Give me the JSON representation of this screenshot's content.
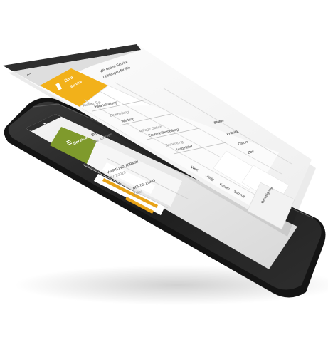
{
  "colors": {
    "phone_body": "#2b2b2b",
    "phone_edge": "#4a4a4a",
    "screen_bg": "#eeeeee",
    "card_bg": "#fafafa",
    "status_bar": "#2e2e2e",
    "accent_yellow": "#f2b11a",
    "accent_green": "#7f9a2c",
    "accent_orange": "#e8a318"
  },
  "card": {
    "status_bar": {
      "signal_icon": "signal-icon",
      "battery_icon": "battery-icon"
    },
    "header": {
      "back_icon": "back-arrow-icon",
      "tile_title": "Diva",
      "tile_subtitle": "Service",
      "tile_icon": "figure-icon",
      "info_line1": "Wir haben Service",
      "info_line2": "Leistungen für Sie"
    },
    "form": {
      "field1_label": "Auftrag Typ",
      "field1_value": "Instandhaltung",
      "field2_label": "Bearbeitung",
      "field2_value": "Wartung",
      "field3_label": "Anfrage Datum",
      "field3_value": "Ersatzteilbestellung",
      "field4_label": "Bemerkung",
      "field4_value": "Ausgeführt",
      "right_labels": [
        "Status",
        "Priorität",
        "Datum",
        "Zeit"
      ],
      "list_items": [
        "Wert",
        "Gültig",
        "Kosten",
        "Summe"
      ],
      "bottom_label": "Bestätigung"
    }
  },
  "phone": {
    "status_bar_icon": "status-icon",
    "tile_title": "Service",
    "tile_menu_icon": "menu-icon",
    "header_text": "Willkommen",
    "subheader_text": "Ihre Aufträge",
    "section_label": "Auftragsliste",
    "list_item1_title": "WARTUNG TERMIN",
    "list_item1_sub": "06.07.2015",
    "list_item2_title": "BESTELLUNG",
    "list_item2_sub": "Offen"
  }
}
